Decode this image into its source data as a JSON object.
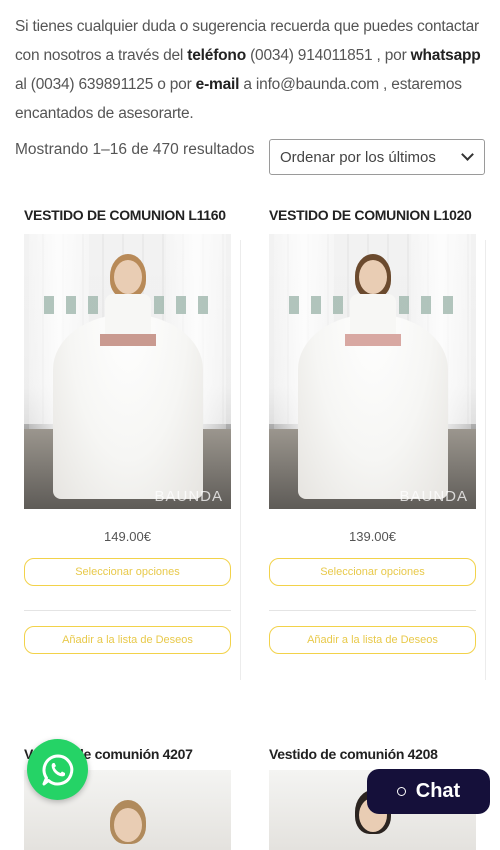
{
  "intro": {
    "t1": "Si tienes cualquier duda o sugerencia recuerda que puedes contactar con nosotros a través del ",
    "phone_label": "teléfono",
    "t2": " (0034) 914011851 , por ",
    "whatsapp_label": "whatsapp",
    "t3": " al (0034) 639891125 o por ",
    "email_label": "e-mail",
    "t4": " a info@baunda.com , estaremos encantados de asesorarte."
  },
  "results_text": "Mostrando 1–16 de 470 resultados",
  "sort": {
    "selected": "Ordenar por los últimos"
  },
  "products": [
    {
      "title": "VESTIDO DE COMUNION L1160",
      "price": "149.00€",
      "select_label": "Seleccionar opciones",
      "wishlist_label": "Añadir a la lista de Deseos",
      "logo": "BAUNDA"
    },
    {
      "title": "VESTIDO DE COMUNION L1020",
      "price": "139.00€",
      "select_label": "Seleccionar opciones",
      "wishlist_label": "Añadir a la lista de Deseos",
      "logo": "BAUNDA"
    },
    {
      "title": "Vestido de comunión 4207"
    },
    {
      "title": "Vestido de comunión 4208"
    }
  ],
  "chat": {
    "label": "Chat"
  },
  "colors": {
    "whatsapp": "#25d366",
    "chat_bg": "#15103a",
    "button_border": "#f2d24a",
    "button_text": "#e8c94a"
  }
}
